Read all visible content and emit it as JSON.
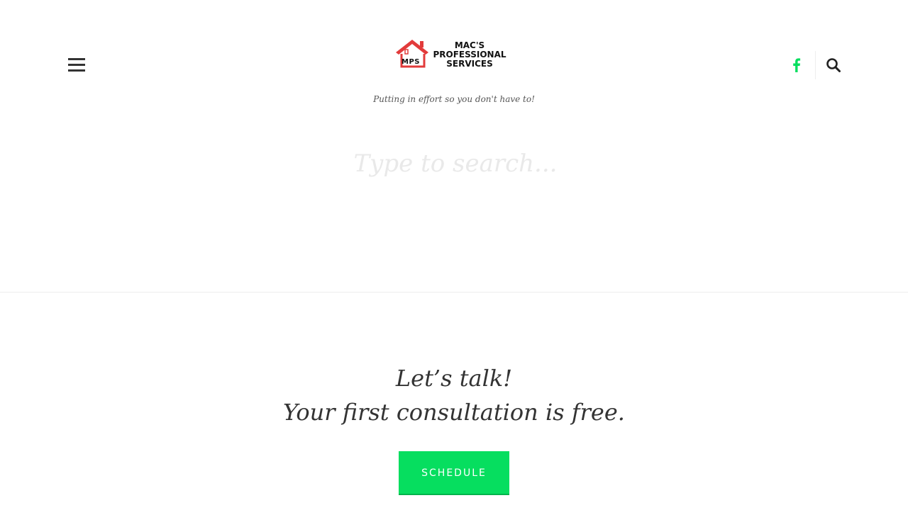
{
  "header": {
    "logo": {
      "badge": "MPS",
      "name_lines": [
        "MAC'S",
        "PROFESSIONAL",
        "SERVICES"
      ]
    },
    "tagline": "Putting in effort so you don't have to!",
    "icons": {
      "menu": "hamburger-menu-icon",
      "social": "facebook-icon",
      "search": "search-icon"
    }
  },
  "search": {
    "placeholder": "Type to search..."
  },
  "cta": {
    "line1": "Let’s talk!",
    "line2": "Your first consultation is free.",
    "button_label": "SCHEDULE"
  },
  "colors": {
    "accent": "#06de5f",
    "logo_red": "#e23b3b",
    "text": "#333333"
  }
}
